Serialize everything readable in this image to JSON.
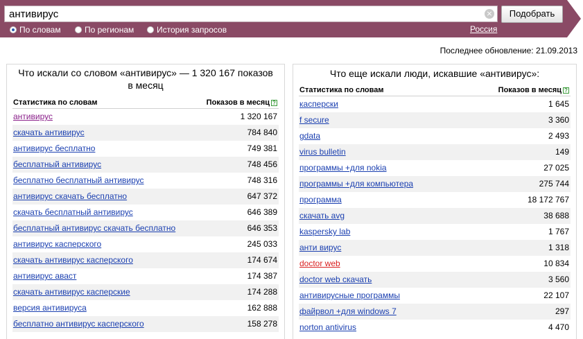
{
  "search": {
    "value": "антивирус",
    "clear_glyph": "×",
    "submit_label": "Подобрать"
  },
  "modes": [
    {
      "label": "По словам",
      "selected": true
    },
    {
      "label": "По регионам",
      "selected": false
    },
    {
      "label": "История запросов",
      "selected": false
    }
  ],
  "region": "Россия",
  "last_update": "Последнее обновление: 21.09.2013",
  "colors": {
    "topbar": "#8a4a65",
    "link": "#1a3fb0",
    "visited": "#8a1f8a",
    "red_link": "#d91f1f",
    "help": "#3a9a3a"
  },
  "left": {
    "title": "Что искали со словом «антивирус» — 1 320 167 показов в месяц",
    "col_words": "Статистика по словам",
    "col_shows": "Показов в месяц",
    "help_glyph": "?",
    "rows": [
      {
        "kw": "антивирус",
        "count": "1 320 167",
        "style": "visited"
      },
      {
        "kw": "скачать антивирус",
        "count": "784 840"
      },
      {
        "kw": "антивирус бесплатно",
        "count": "749 381"
      },
      {
        "kw": "бесплатный антивирус",
        "count": "748 456"
      },
      {
        "kw": "бесплатно бесплатный антивирус",
        "count": "748 316"
      },
      {
        "kw": "антивирус скачать бесплатно",
        "count": "647 372"
      },
      {
        "kw": "скачать бесплатный антивирус",
        "count": "646 389"
      },
      {
        "kw": "бесплатный антивирус скачать бесплатно",
        "count": "646 353"
      },
      {
        "kw": "антивирус касперского",
        "count": "245 033"
      },
      {
        "kw": "скачать антивирус касперского",
        "count": "174 674"
      },
      {
        "kw": "антивирус аваст",
        "count": "174 387"
      },
      {
        "kw": "скачать антивирус касперские",
        "count": "174 288"
      },
      {
        "kw": "версия антивируса",
        "count": "162 888"
      },
      {
        "kw": "бесплатно антивирус касперского",
        "count": "158 278"
      }
    ]
  },
  "right": {
    "title": "Что еще искали люди, искавшие «антивирус»:",
    "col_words": "Статистика по словам",
    "col_shows": "Показов в месяц",
    "help_glyph": "?",
    "rows": [
      {
        "kw": "касперски",
        "count": "1 645"
      },
      {
        "kw": "f secure",
        "count": "3 360"
      },
      {
        "kw": "gdata",
        "count": "2 493"
      },
      {
        "kw": "virus bulletin",
        "count": "149"
      },
      {
        "kw": "программы +для nokia",
        "count": "27 025"
      },
      {
        "kw": "программы +для компьютера",
        "count": "275 744"
      },
      {
        "kw": "программа",
        "count": "18 172 767"
      },
      {
        "kw": "скачать avg",
        "count": "38 688"
      },
      {
        "kw": "kaspersky lab",
        "count": "1 767"
      },
      {
        "kw": "анти вирус",
        "count": "1 318"
      },
      {
        "kw": "doctor web",
        "count": "10 834",
        "style": "red"
      },
      {
        "kw": "doctor web скачать",
        "count": "3 560"
      },
      {
        "kw": "антивирусные программы",
        "count": "22 107"
      },
      {
        "kw": "файрвол +для windows 7",
        "count": "297"
      },
      {
        "kw": "norton antivirus",
        "count": "4 470"
      }
    ]
  }
}
